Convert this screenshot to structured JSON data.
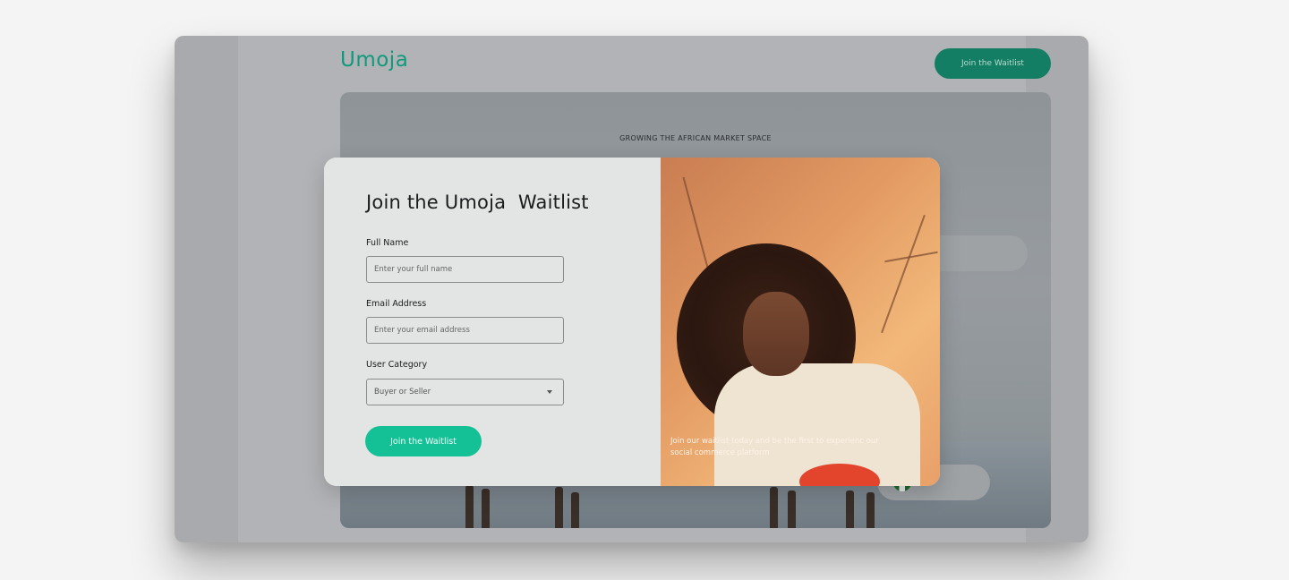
{
  "header": {
    "logo": "Umoja",
    "cta_label": "Join the Waitlist"
  },
  "hero": {
    "eyebrow": "GROWING THE AFRICAN MARKET SPACE"
  },
  "modal": {
    "title": "Join the Umoja  Waitlist",
    "full_name_label": "Full Name",
    "full_name_placeholder": "Enter your full name",
    "email_label": "Email Address",
    "email_placeholder": "Enter your email address",
    "category_label": "User Category",
    "category_value": "Buyer or Seller",
    "submit_label": "Join the Waitlist",
    "caption": "Join our waitlist today and be the first to experienc our social commerce platform"
  },
  "colors": {
    "brand": "#14c196",
    "brand_dark": "#137e64",
    "logo": "#109a7c"
  }
}
